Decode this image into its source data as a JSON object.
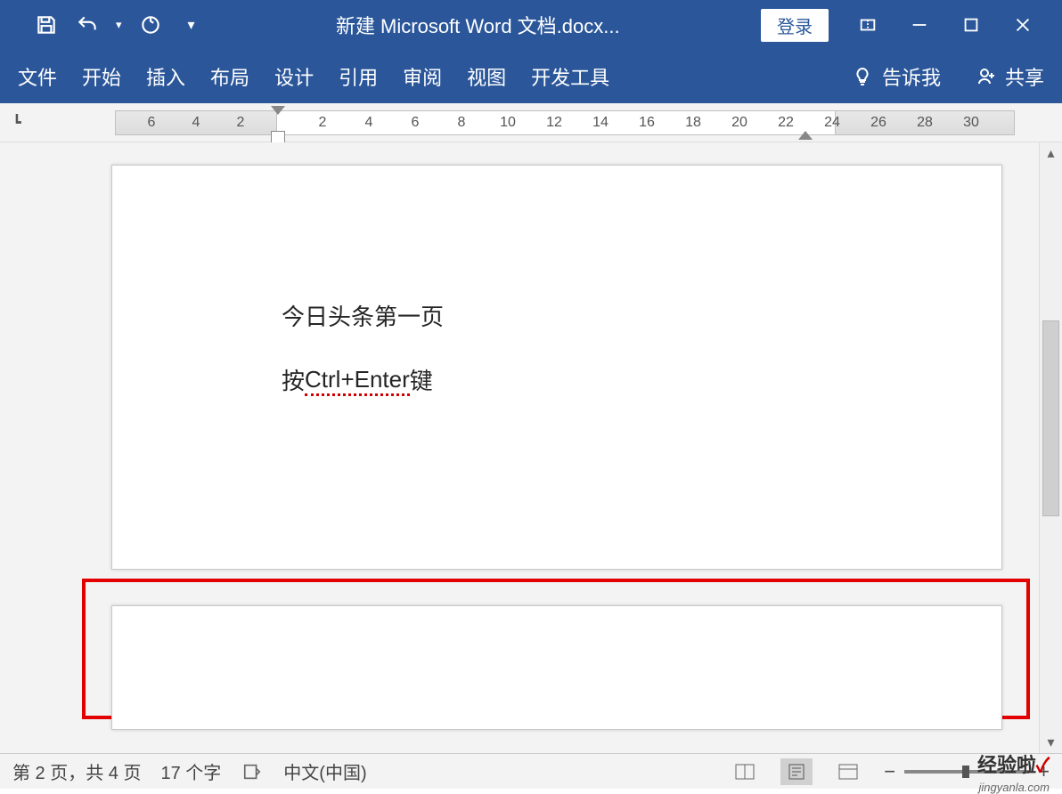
{
  "titlebar": {
    "title": "新建 Microsoft Word 文档.docx...",
    "login": "登录"
  },
  "ribbon": {
    "tabs": [
      "文件",
      "开始",
      "插入",
      "布局",
      "设计",
      "引用",
      "审阅",
      "视图",
      "开发工具"
    ],
    "tell_me": "告诉我",
    "share": "共享"
  },
  "ruler": {
    "left": [
      "6",
      "4",
      "2"
    ],
    "right": [
      "2",
      "4",
      "6",
      "8",
      "10",
      "12",
      "14",
      "16",
      "18",
      "20",
      "22",
      "24",
      "26",
      "28",
      "30"
    ]
  },
  "document": {
    "line1": "今日头条第一页",
    "line2_a": "按 ",
    "line2_b": "Ctrl+Enter",
    "line2_c": " 键"
  },
  "status": {
    "page": "第 2 页，共 4 页",
    "words": "17 个字",
    "lang": "中文(中国)"
  },
  "watermark": {
    "main_a": "经验啦",
    "main_b": "✓",
    "sub": "jingyanla.com"
  }
}
